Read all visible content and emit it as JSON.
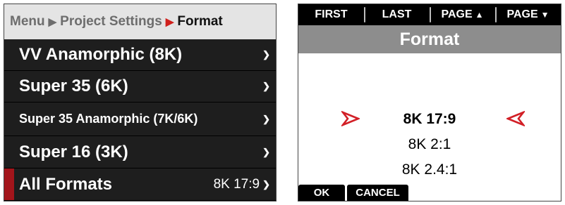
{
  "left_panel": {
    "breadcrumb": {
      "items": [
        "Menu",
        "Project Settings",
        "Format"
      ],
      "separator": ">"
    },
    "rows": [
      {
        "label": "VV Anamorphic (8K)",
        "value": "",
        "chevron": "chevron-down-icon"
      },
      {
        "label": "Super 35 (6K)",
        "value": "",
        "chevron": "chevron-down-icon"
      },
      {
        "label": "Super 35 Anamorphic (7K/6K)",
        "value": "",
        "chevron": "chevron-down-icon"
      },
      {
        "label": "Super 16 (3K)",
        "value": "",
        "chevron": "chevron-down-icon"
      },
      {
        "label": "All Formats",
        "value": "8K 17:9",
        "chevron": "chevron-down-icon",
        "selected": true
      }
    ],
    "colors": {
      "highlight": "#a3151b",
      "separator_active": "#d0201c"
    }
  },
  "right_panel": {
    "softkeys": [
      {
        "label": "FIRST",
        "icon": ""
      },
      {
        "label": "LAST",
        "icon": ""
      },
      {
        "label": "PAGE",
        "icon": "triangle-up-icon"
      },
      {
        "label": "PAGE",
        "icon": "triangle-down-icon"
      }
    ],
    "title": "Format",
    "options": [
      {
        "label": "8K 17:9",
        "selected": true
      },
      {
        "label": "8K 2:1",
        "selected": false
      },
      {
        "label": "8K 2.4:1",
        "selected": false
      }
    ],
    "bottom_keys": [
      {
        "label": "OK"
      },
      {
        "label": "CANCEL"
      }
    ],
    "colors": {
      "arrow": "#d21f26",
      "title_bar": "#8d8d8d"
    }
  }
}
